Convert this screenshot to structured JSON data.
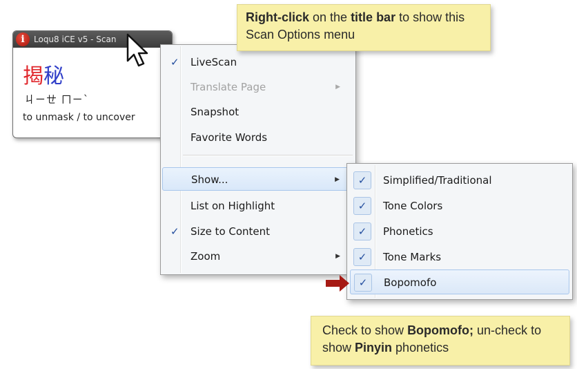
{
  "window": {
    "title": "Loqu8 iCE v5 - Scan",
    "info_icon": "i",
    "hanzi_1": "揭",
    "hanzi_2": "秘",
    "bopomofo": "ㄐㄧㄝ ㄇㄧˋ",
    "definition": "to unmask / to uncover",
    "tone_colors": {
      "first": "#e0262b",
      "second": "#2f3ec8"
    }
  },
  "menu": {
    "items": [
      {
        "label": "LiveScan",
        "checked": true,
        "submenu": false,
        "enabled": true
      },
      {
        "label": "Translate Page",
        "checked": false,
        "submenu": true,
        "enabled": false
      },
      {
        "label": "Snapshot",
        "checked": false,
        "submenu": false,
        "enabled": true
      },
      {
        "label": "Favorite Words",
        "checked": false,
        "submenu": false,
        "enabled": true
      },
      {
        "label": "Show...",
        "checked": false,
        "submenu": true,
        "enabled": true,
        "highlighted": true
      },
      {
        "label": "List on Highlight",
        "checked": false,
        "submenu": false,
        "enabled": true
      },
      {
        "label": "Size to Content",
        "checked": true,
        "submenu": false,
        "enabled": true
      },
      {
        "label": "Zoom",
        "checked": false,
        "submenu": true,
        "enabled": true
      }
    ]
  },
  "submenu": {
    "items": [
      {
        "label": "Simplified/Traditional",
        "checked": true
      },
      {
        "label": "Tone Colors",
        "checked": true
      },
      {
        "label": "Phonetics",
        "checked": true
      },
      {
        "label": "Tone Marks",
        "checked": true
      },
      {
        "label": "Bopomofo",
        "checked": true,
        "highlighted": true
      }
    ]
  },
  "symbols": {
    "check": "✓",
    "arrow": "▶"
  },
  "callout_top": {
    "bold1": "Right-click",
    "text1": " on the ",
    "bold2": "title bar",
    "text2": " to show this Scan Options menu"
  },
  "callout_bottom": {
    "text1": "Check to show ",
    "bold1": "Bopomofo;",
    "text2": " un-check to show ",
    "bold2": "Pinyin",
    "text3": " phonetics"
  },
  "colors": {
    "callout_bg": "#f8f0a8",
    "check_color": "#244e9e",
    "arrow_color": "#a61a14"
  }
}
